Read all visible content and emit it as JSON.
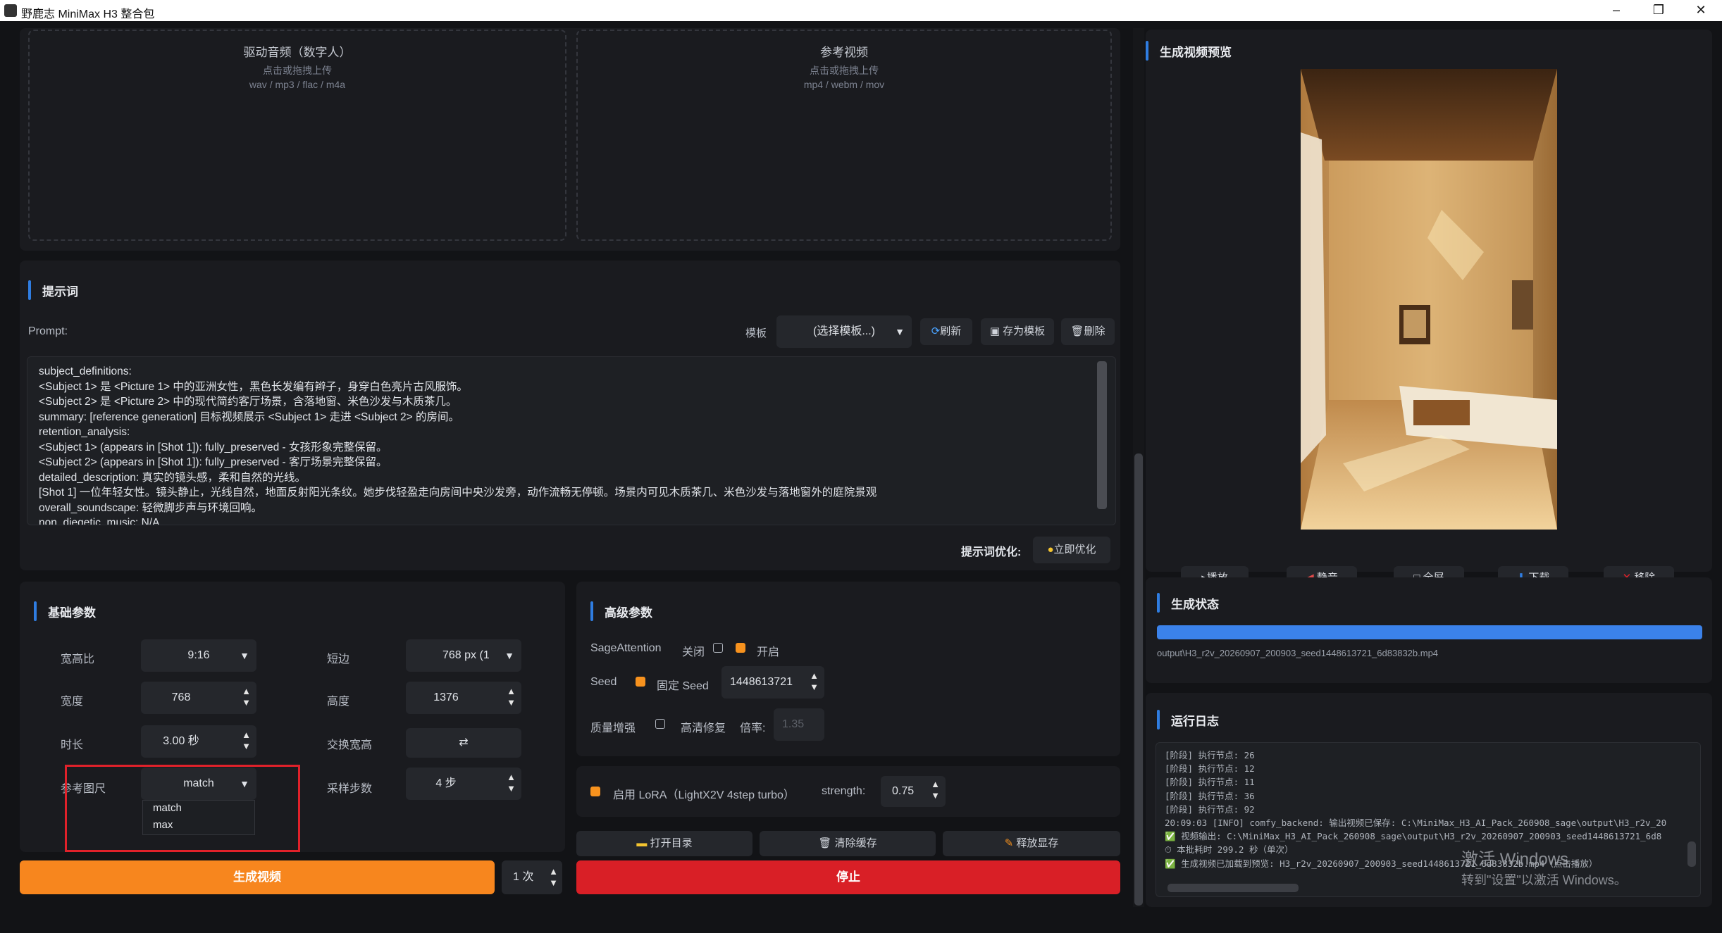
{
  "window": {
    "title": "野鹿志 MiniMax H3 整合包",
    "minimize": "–",
    "restore": "❐",
    "close": "✕"
  },
  "upload": {
    "audio": {
      "title": "驱动音频（数字人）",
      "hint": "点击或拖拽上传",
      "formats": "wav / mp3 / flac / m4a"
    },
    "video": {
      "title": "参考视频",
      "hint": "点击或拖拽上传",
      "formats": "mp4 / webm / mov"
    }
  },
  "prompt_section": {
    "title": "提示词",
    "prompt_label": "Prompt:",
    "template_label": "模板",
    "template_select": "(选择模板...)",
    "refresh": "刷新",
    "save_template": "存为模板",
    "delete": "删除",
    "lines": [
      "subject_definitions:",
      "<Subject 1> 是 <Picture 1> 中的亚洲女性，黑色长发编有辫子，身穿白色亮片古风服饰。",
      "<Subject 2> 是 <Picture 2> 中的现代简约客厅场景，含落地窗、米色沙发与木质茶几。",
      "summary: [reference generation] 目标视频展示 <Subject 1> 走进 <Subject 2> 的房间。",
      "retention_analysis:",
      "<Subject 1> (appears in [Shot 1]): fully_preserved - 女孩形象完整保留。",
      "<Subject 2> (appears in [Shot 1]): fully_preserved - 客厅场景完整保留。",
      "detailed_description: 真实的镜头感，柔和自然的光线。",
      "[Shot 1] 一位年轻女性。镜头静止，光线自然，地面反射阳光条纹。她步伐轻盈走向房间中央沙发旁，动作流畅无停顿。场景内可见木质茶几、米色沙发与落地窗外的庭院景观",
      "overall_soundscape: 轻微脚步声与环境回响。",
      "non_diegetic_music: N/A"
    ],
    "optimize_label": "提示词优化:",
    "optimize_button": "立即优化"
  },
  "basic_params": {
    "title": "基础参数",
    "aspect_label": "宽高比",
    "aspect_value": "9:16",
    "short_side_label": "短边",
    "short_side_value": "768 px (1",
    "width_label": "宽度",
    "width_value": "768",
    "height_label": "高度",
    "height_value": "1376",
    "duration_label": "时长",
    "duration_value": "3.00 秒",
    "swap_label": "交换宽高",
    "swap_icon": "⇄",
    "ref_size_label": "参考图尺",
    "ref_size_value": "match",
    "ref_size_options": [
      "match",
      "max"
    ],
    "steps_label": "采样步数",
    "steps_value": "4 步"
  },
  "advanced_params": {
    "title": "高级参数",
    "sage_label": "SageAttention",
    "sage_off": "关闭",
    "sage_on": "开启",
    "seed_label": "Seed",
    "fixed_seed_label": "固定 Seed",
    "seed_value": "1448613721",
    "quality_label": "质量增强",
    "hd_label": "高清修复",
    "ratio_label": "倍率:",
    "ratio_value": "1.35",
    "lora_label": "启用 LoRA（LightX2V 4step turbo）",
    "strength_label": "strength:",
    "strength_value": "0.75"
  },
  "actions": {
    "open_dir": "打开目录",
    "clear_cache": "清除缓存",
    "free_vram": "释放显存",
    "generate": "生成视频",
    "count": "1 次",
    "stop": "停止"
  },
  "preview": {
    "title": "生成视频预览",
    "play": "播放",
    "mute": "静音",
    "fullscreen": "全屏",
    "download": "下载",
    "remove": "移除"
  },
  "status": {
    "title": "生成状态",
    "progress": 1.0,
    "output_path": "output\\H3_r2v_20260907_200903_seed1448613721_6d83832b.mp4"
  },
  "log": {
    "title": "运行日志",
    "lines": [
      "[阶段] 执行节点: 26",
      "[阶段] 执行节点: 12",
      "[阶段] 执行节点: 11",
      "[阶段] 执行节点: 36",
      "[阶段] 执行节点: 92",
      "20:09:03 [INFO] comfy_backend: 输出视频已保存: C:\\MiniMax_H3_AI_Pack_260908_sage\\output\\H3_r2v_20",
      "✅ 视频输出: C:\\MiniMax_H3_AI_Pack_260908_sage\\output\\H3_r2v_20260907_200903_seed1448613721_6d8",
      "⏱ 本批耗时 299.2 秒（单次）",
      "✅ 生成视频已加载到预览: H3_r2v_20260907_200903_seed1448613721_6d83832b.mp4（点击播放）"
    ]
  },
  "watermark": {
    "line1": "激活 Windows",
    "line2": "转到\"设置\"以激活 Windows。"
  },
  "colors": {
    "accent_blue": "#2f7de1",
    "orange": "#f7921e",
    "red": "#d91f26",
    "highlight": "#e0212a"
  }
}
